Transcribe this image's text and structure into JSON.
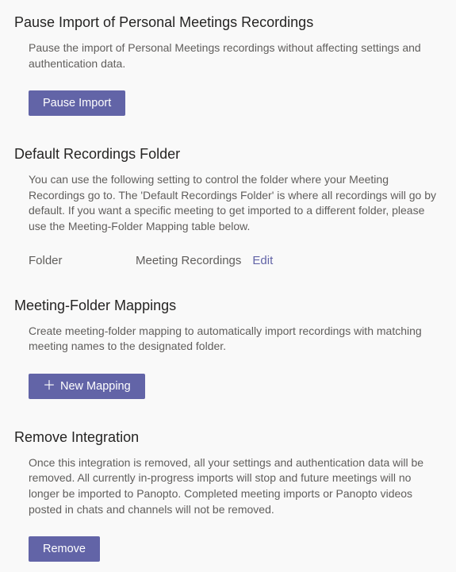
{
  "pause_import": {
    "title": "Pause Import of Personal Meetings Recordings",
    "desc": "Pause the import of Personal Meetings recordings without affecting settings and authentication data.",
    "button_label": "Pause Import"
  },
  "default_folder": {
    "title": "Default Recordings Folder",
    "desc": "You can use the following setting to control the folder where your Meeting Recordings go to. The 'Default Recordings Folder' is where all recordings will go by default. If you want a specific meeting to get imported to a different folder, please use the Meeting-Folder Mapping table below.",
    "folder_label": "Folder",
    "folder_value": "Meeting Recordings",
    "edit_label": "Edit"
  },
  "mappings": {
    "title": "Meeting-Folder Mappings",
    "desc": "Create meeting-folder mapping to automatically import recordings with matching meeting names to the designated folder.",
    "button_label": "New Mapping"
  },
  "remove": {
    "title": "Remove Integration",
    "desc": "Once this integration is removed, all your settings and authentication data will be removed. All currently in-progress imports will stop and future meetings will no longer be imported to Panopto. Completed meeting imports or Panopto videos posted in chats and channels will not be removed.",
    "button_label": "Remove"
  }
}
